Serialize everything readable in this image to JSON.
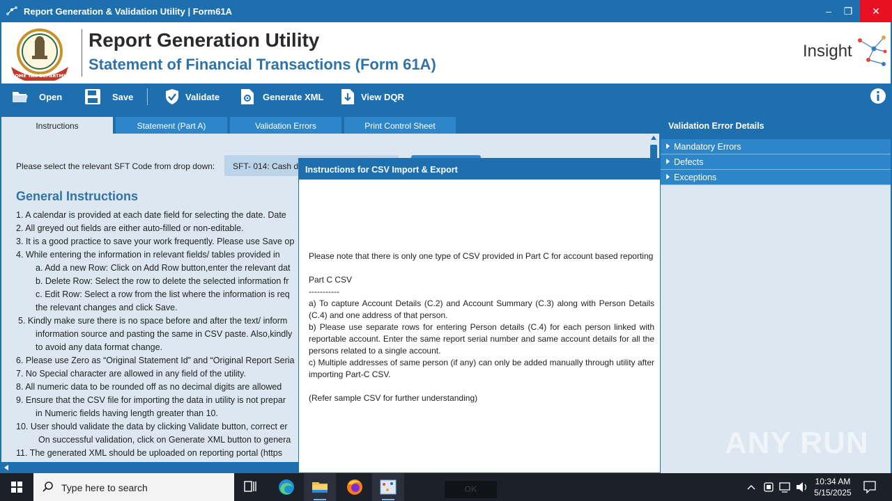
{
  "window": {
    "title": "Report Generation & Validation Utility | Form61A",
    "min": "–",
    "max": "❐",
    "close": "✕"
  },
  "header": {
    "title": "Report Generation Utility",
    "subtitle": "Statement of Financial Transactions (Form 61A)",
    "brand": "Insight",
    "emblem_text": "INCOME TAX DEPARTMENT"
  },
  "toolbar": {
    "open": "Open",
    "save": "Save",
    "validate": "Validate",
    "generate_xml": "Generate XML",
    "view_dqr": "View DQR"
  },
  "tabs": [
    {
      "label": "Instructions",
      "active": true
    },
    {
      "label": "Statement (Part A)",
      "active": false
    },
    {
      "label": "Validation Errors",
      "active": false
    },
    {
      "label": "Print Control Sheet",
      "active": false
    }
  ],
  "main": {
    "sft_label": "Please select the relevant SFT Code from drop down:",
    "sft_value": "SFT- 014: Cash de",
    "gi_title": "General Instructions",
    "lines": [
      "1. A calendar is provided at each date field for selecting the date. Date",
      "2. All greyed out fields are either auto-filled or non-editable.",
      "3. It is a good practice to save your work frequently. Please use Save op",
      "4. While entering the information in relevant fields/ tables provided in",
      "a. Add a new Row: Click on Add Row button,enter the relevant dat",
      "b. Delete Row: Select the row to delete the selected information fr",
      "c. Edit Row: Select a row from the list where the information is req",
      "the relevant changes and click Save.",
      "5. Kindly make sure there is no space before and after the text/ inform",
      "information source and pasting the same in CSV paste. Also,kindly",
      "to avoid any data format change.",
      "6. Please use Zero as “Original Statement Id” and “Original Report Seria",
      "7. No Special character are allowed in any field of the utility.",
      "8. All numeric data to be rounded off as no decimal digits are allowed",
      "9. Ensure that the CSV file for importing the data in utility is not prepar",
      "in Numeric fields having length greater than 10.",
      "10. User should validate the data by clicking Validate button, correct er",
      "On successful validation, click on Generate XML button to genera",
      "11. The generated  XML should be uploaded on reporting portal (https"
    ]
  },
  "right_panel": {
    "title": "Validation Error Details",
    "items": [
      "Mandatory Errors",
      "Defects",
      "Exceptions"
    ]
  },
  "dialog": {
    "title": "Instructions for CSV Import & Export",
    "note": "Please note that there is only one type of CSV provided in Part C for account based reporting",
    "part_heading": "Part C CSV",
    "dashes": "-----------",
    "a": "a) To capture Account Details (C.2) and Account Summary (C.3) along with Person Details (C.4) and one address of that person.",
    "b": "b) Please use separate rows for entering Person details (C.4) for each person linked with reportable account. Enter the same report serial number and same account details for all the persons related to a single account.",
    "c": "c) Multiple addresses of same person (if any) can only be added manually through utility after importing Part-C CSV.",
    "refer": "(Refer sample CSV for further understanding)",
    "ok": "OK"
  },
  "watermark": "ANY RUN",
  "taskbar": {
    "search_placeholder": "Type here to search",
    "time": "10:34 AM",
    "date": "5/15/2025"
  },
  "colors": {
    "primary": "#1e6fae",
    "tab": "#2d86c9",
    "panel_bg": "#dce7f1",
    "heading": "#2f73a7",
    "close": "#e81123"
  }
}
